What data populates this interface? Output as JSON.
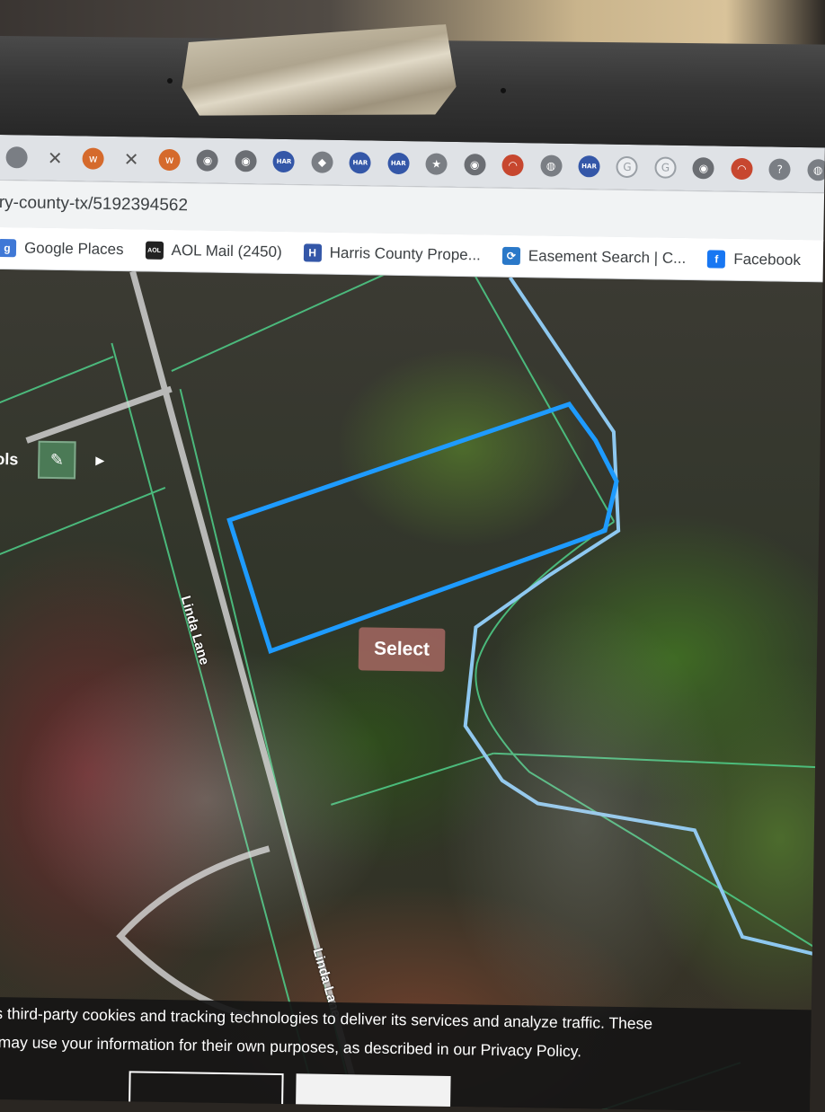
{
  "browser": {
    "tabs": [
      {
        "icon": "generic-tab-icon",
        "glyph": ""
      },
      {
        "icon": "x-tab-icon",
        "glyph": "✕"
      },
      {
        "icon": "orange-tab-icon",
        "glyph": "w"
      },
      {
        "icon": "close-tab-icon",
        "glyph": "✕"
      },
      {
        "icon": "orange-tab-icon",
        "glyph": "w"
      },
      {
        "icon": "github-tab-icon",
        "glyph": "◉"
      },
      {
        "icon": "github-tab-icon",
        "glyph": "◉"
      },
      {
        "icon": "har-tab-icon",
        "glyph": "HAR"
      },
      {
        "icon": "cube-tab-icon",
        "glyph": "◆"
      },
      {
        "icon": "har-tab-icon",
        "glyph": "HAR"
      },
      {
        "icon": "har-tab-icon",
        "glyph": "HAR"
      },
      {
        "icon": "star-tab-icon",
        "glyph": "★"
      },
      {
        "icon": "github-tab-icon",
        "glyph": "◉"
      },
      {
        "icon": "red-tab-icon",
        "glyph": "◠"
      },
      {
        "icon": "globe-tab-icon",
        "glyph": "◍"
      },
      {
        "icon": "har-tab-icon",
        "glyph": "HAR"
      },
      {
        "icon": "google-tab-icon",
        "glyph": "G"
      },
      {
        "icon": "google-tab-icon",
        "glyph": "G"
      },
      {
        "icon": "github-tab-icon",
        "glyph": "◉"
      },
      {
        "icon": "red-tab-icon",
        "glyph": "◠"
      },
      {
        "icon": "help-tab-icon",
        "glyph": "?"
      },
      {
        "icon": "generic-tab-icon",
        "glyph": "◍"
      }
    ],
    "address_bar": {
      "url": "ry-county-tx/5192394562"
    },
    "bookmarks": [
      {
        "label": "Google Places",
        "icon": "google-places-icon",
        "color": "#3f78d6",
        "glyph": "g"
      },
      {
        "label": "AOL Mail (2450)",
        "icon": "aol-icon",
        "color": "#222222",
        "glyph": "AOL"
      },
      {
        "label": "Harris County Prope...",
        "icon": "har-icon",
        "color": "#3457a8",
        "glyph": "H"
      },
      {
        "label": "Easement Search | C...",
        "icon": "refresh-icon",
        "color": "#2a78c8",
        "glyph": "⟳"
      },
      {
        "label": "Facebook",
        "icon": "facebook-icon",
        "color": "#1877f2",
        "glyph": "f"
      }
    ]
  },
  "map": {
    "toolbar_label": "ols",
    "tool_icon": "identify-tool-icon",
    "select_button": "Select",
    "street_labels": [
      "Linda Lane",
      "Linda Lane"
    ],
    "colors": {
      "parcel_lines": "#4fd08a",
      "selected_parcel": "#1e9bff",
      "flood_boundary": "#8ec8f0",
      "road": "#d9d9d9"
    }
  },
  "cookie_banner": {
    "line1": "es third-party cookies and tracking technologies to deliver its services and analyze traffic. These",
    "line2": "s may use your information for their own purposes, as described in our Privacy Policy."
  }
}
